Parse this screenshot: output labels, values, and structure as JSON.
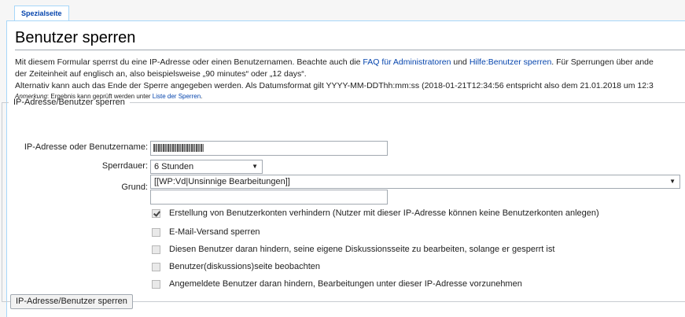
{
  "tabs": {
    "special_page": "Spezialseite"
  },
  "page": {
    "title": "Benutzer sperren",
    "intro_line1_a": "Mit diesem Formular sperrst du eine IP-Adresse oder einen Benutzernamen. Beachte auch die ",
    "link_faq": "FAQ für Administratoren",
    "intro_and": " und ",
    "link_help": "Hilfe:Benutzer sperren",
    "intro_line1_b": ". Für Sperrungen über ande",
    "intro_line2": "der Zeiteinheit auf englisch an, also beispielsweise „90 minutes“ oder „12 days“.",
    "intro_line3": "Alternativ kann auch das Ende der Sperre angegeben werden. Als Datumsformat gilt YYYY-MM-DDThh:mm:ss (2018-01-21T12:34:56 entspricht also dem 21.01.2018 um 12:3",
    "note_label": "Anmerkung",
    "note_text": ": Ergebnis kann geprüft werden unter ",
    "link_blocklist": "Liste der Sperren",
    "note_end": "."
  },
  "form": {
    "legend": "IP-Adresse/Benutzer sperren",
    "target_label": "IP-Adresse oder Benutzername:",
    "duration_label": "Sperrdauer:",
    "duration_value": "6 Stunden",
    "reason_label": "Grund:",
    "reason_value": "[[WP:Vd|Unsinnige Bearbeitungen]]",
    "reason_other": "",
    "checkboxes": [
      {
        "label": "Erstellung von Benutzerkonten verhindern (Nutzer mit dieser IP-Adresse können keine Benutzerkonten anlegen)",
        "checked": true
      },
      {
        "label": "E-Mail-Versand sperren",
        "checked": false
      },
      {
        "label": "Diesen Benutzer daran hindern, seine eigene Diskussionsseite zu bearbeiten, solange er gesperrt ist",
        "checked": false
      },
      {
        "label": "Benutzer(diskussions)seite beobachten",
        "checked": false
      },
      {
        "label": "Angemeldete Benutzer daran hindern, Bearbeitungen unter dieser IP-Adresse vorzunehmen",
        "checked": false
      }
    ],
    "submit_label": "IP-Adresse/Benutzer sperren"
  },
  "colors": {
    "link": "#0645ad",
    "tab_border": "#a7d7f9"
  }
}
